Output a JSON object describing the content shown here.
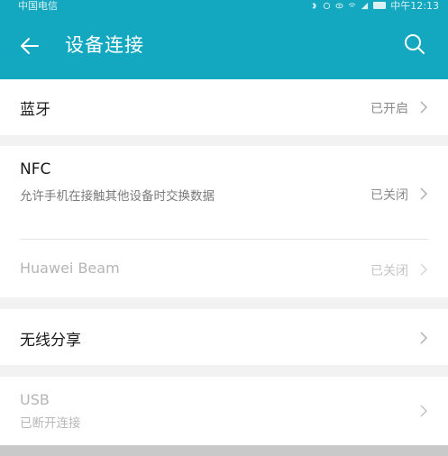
{
  "status_bar": {
    "carrier": "中国电信",
    "time": "中午12:13"
  },
  "app_bar": {
    "title": "设备连接",
    "back_icon": "arrow-left-icon",
    "search_icon": "search-icon"
  },
  "colors": {
    "accent": "#13a8bf",
    "background": "#f2f2f2",
    "card": "#ffffff",
    "text_primary": "#1a1a1a",
    "text_secondary": "#8a8a8a",
    "text_disabled": "#b5b5b5"
  },
  "items": {
    "bluetooth": {
      "label": "蓝牙",
      "value": "已开启"
    },
    "nfc": {
      "label": "NFC",
      "description": "允许手机在接触其他设备时交换数据",
      "value": "已关闭"
    },
    "huawei_beam": {
      "label": "Huawei Beam",
      "value": "已关闭"
    },
    "wireless_share": {
      "label": "无线分享"
    },
    "usb": {
      "label": "USB",
      "description": "已断开连接"
    }
  }
}
